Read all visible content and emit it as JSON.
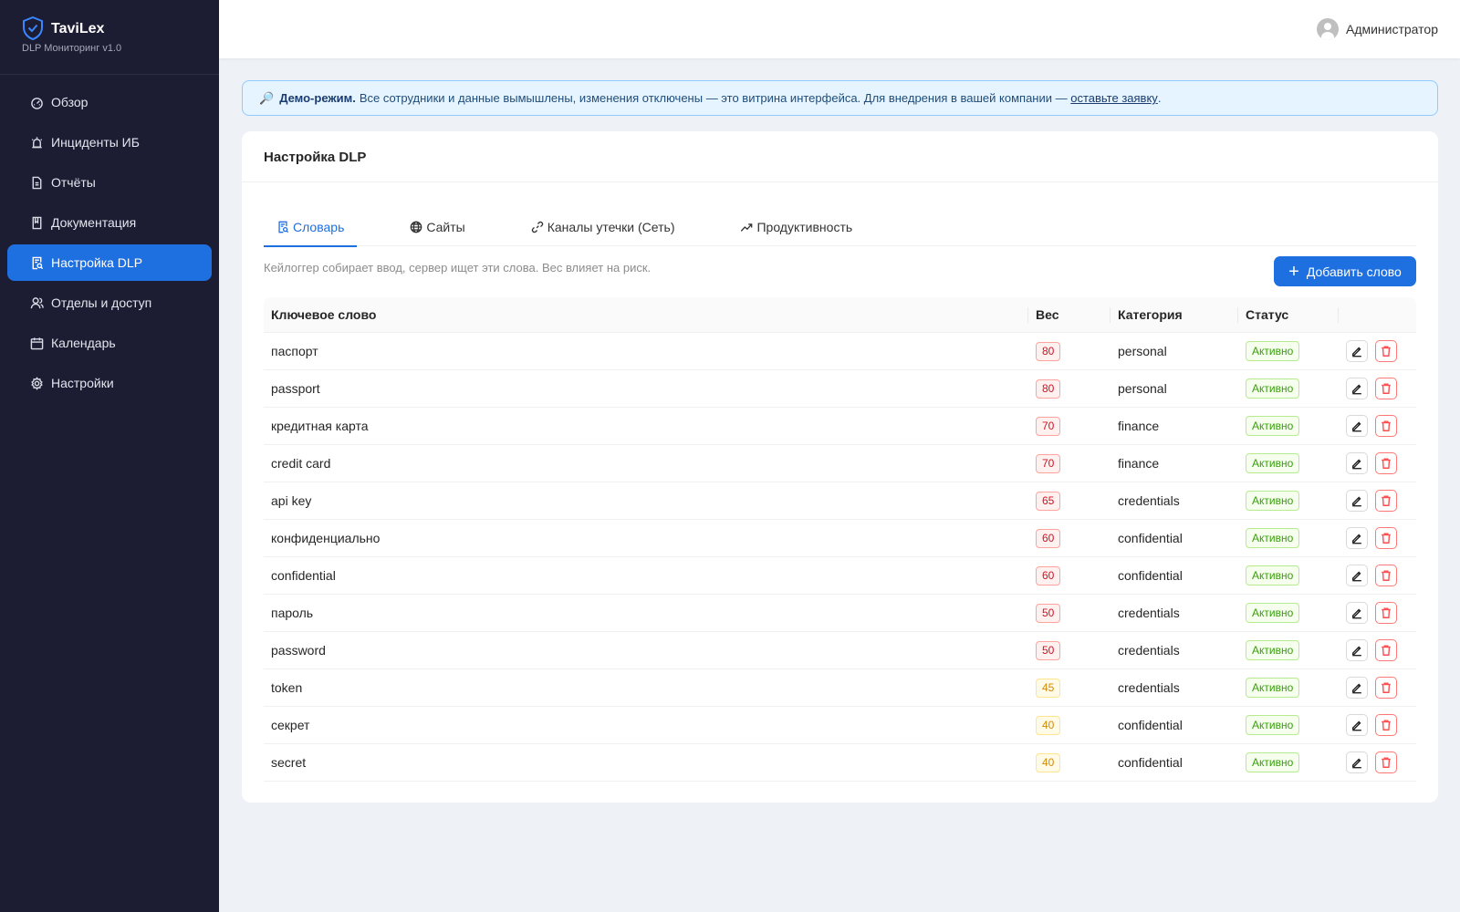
{
  "brand": {
    "name": "TaviLex",
    "subtitle": "DLP Мониторинг v1.0"
  },
  "sidebar": {
    "items": [
      {
        "label": "Обзор",
        "icon": "dashboard-icon"
      },
      {
        "label": "Инциденты ИБ",
        "icon": "alarm-icon"
      },
      {
        "label": "Отчёты",
        "icon": "file-icon"
      },
      {
        "label": "Документация",
        "icon": "book-icon"
      },
      {
        "label": "Настройка DLP",
        "icon": "file-search-icon",
        "active": true
      },
      {
        "label": "Отделы и доступ",
        "icon": "team-icon"
      },
      {
        "label": "Календарь",
        "icon": "calendar-icon"
      },
      {
        "label": "Настройки",
        "icon": "gear-icon"
      }
    ]
  },
  "header": {
    "user_name": "Администратор"
  },
  "banner": {
    "icon": "🔎",
    "title": "Демо-режим.",
    "text": "Все сотрудники и данные вымышлены, изменения отключены — это витрина интерфейса. Для внедрения в вашей компании —",
    "link": "оставьте заявку",
    "tail": "."
  },
  "card": {
    "title": "Настройка DLP",
    "tabs": [
      {
        "label": "Словарь",
        "icon": "file-search-icon",
        "active": true
      },
      {
        "label": "Сайты",
        "icon": "globe-icon"
      },
      {
        "label": "Каналы утечки (Сеть)",
        "icon": "link-icon"
      },
      {
        "label": "Продуктивность",
        "icon": "rise-icon"
      }
    ],
    "hint": "Кейлоггер собирает ввод, сервер ищет эти слова. Вес влияет на риск.",
    "add_button": "Добавить слово"
  },
  "table": {
    "columns": [
      "Ключевое слово",
      "Вес",
      "Категория",
      "Статус",
      ""
    ],
    "rows": [
      {
        "keyword": "паспорт",
        "weight": "80",
        "category": "personal",
        "status": "Активно"
      },
      {
        "keyword": "passport",
        "weight": "80",
        "category": "personal",
        "status": "Активно"
      },
      {
        "keyword": "кредитная карта",
        "weight": "70",
        "category": "finance",
        "status": "Активно"
      },
      {
        "keyword": "credit card",
        "weight": "70",
        "category": "finance",
        "status": "Активно"
      },
      {
        "keyword": "api key",
        "weight": "65",
        "category": "credentials",
        "status": "Активно"
      },
      {
        "keyword": "конфиденциально",
        "weight": "60",
        "category": "confidential",
        "status": "Активно"
      },
      {
        "keyword": "confidential",
        "weight": "60",
        "category": "confidential",
        "status": "Активно"
      },
      {
        "keyword": "пароль",
        "weight": "50",
        "category": "credentials",
        "status": "Активно"
      },
      {
        "keyword": "password",
        "weight": "50",
        "category": "credentials",
        "status": "Активно"
      },
      {
        "keyword": "token",
        "weight": "45",
        "category": "credentials",
        "status": "Активно"
      },
      {
        "keyword": "секрет",
        "weight": "40",
        "category": "confidential",
        "status": "Активно"
      },
      {
        "keyword": "secret",
        "weight": "40",
        "category": "confidential",
        "status": "Активно"
      }
    ]
  },
  "colors": {
    "accent": "#1e6fe0",
    "sidebar": "#1c1d32",
    "weight_high": "#cf1322",
    "weight_mid": "#d48806",
    "status_active": "#389e0d"
  }
}
